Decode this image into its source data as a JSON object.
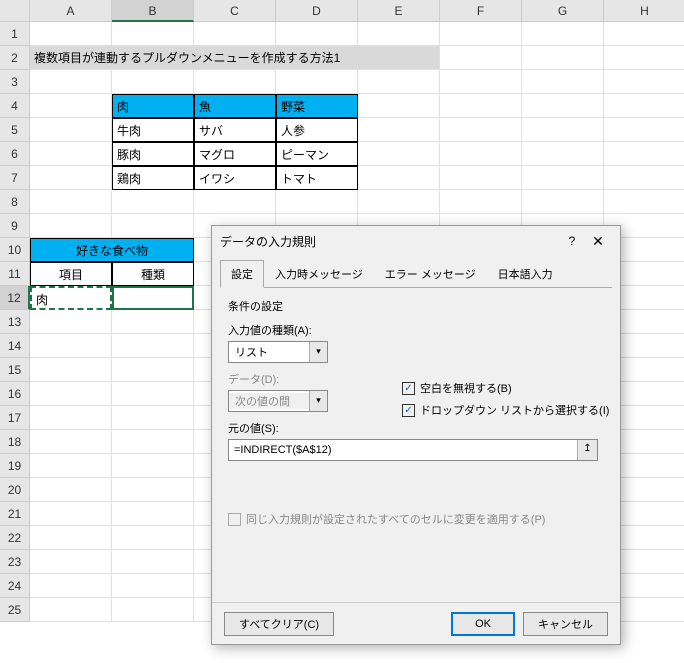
{
  "columns": [
    "A",
    "B",
    "C",
    "D",
    "E",
    "F",
    "G",
    "H"
  ],
  "rows": [
    "1",
    "2",
    "3",
    "4",
    "5",
    "6",
    "7",
    "8",
    "9",
    "10",
    "11",
    "12",
    "13",
    "14",
    "15",
    "16",
    "17",
    "18",
    "19",
    "20",
    "21",
    "22",
    "23",
    "24",
    "25"
  ],
  "title_row": "複数項目が連動するプルダウンメニューを作成する方法1",
  "table": {
    "headers": [
      "肉",
      "魚",
      "野菜"
    ],
    "data": [
      [
        "牛肉",
        "サバ",
        "人参"
      ],
      [
        "豚肉",
        "マグロ",
        "ピーマン"
      ],
      [
        "鶏肉",
        "イワシ",
        "トマト"
      ]
    ]
  },
  "fav": {
    "title": "好きな食べ物",
    "col1": "項目",
    "col2": "種類",
    "val1": "肉"
  },
  "dialog": {
    "title": "データの入力規則",
    "help": "?",
    "close": "✕",
    "tabs": [
      "設定",
      "入力時メッセージ",
      "エラー メッセージ",
      "日本語入力"
    ],
    "section": "条件の設定",
    "type_label": "入力値の種類(A):",
    "type_value": "リスト",
    "check1": "空白を無視する(B)",
    "check2": "ドロップダウン リストから選択する(I)",
    "data_label": "データ(D):",
    "data_value": "次の値の間",
    "source_label": "元の値(S):",
    "source_value": "=INDIRECT($A$12)",
    "apply_all": "同じ入力規則が設定されたすべてのセルに変更を適用する(P)",
    "clear": "すべてクリア(C)",
    "ok": "OK",
    "cancel": "キャンセル"
  }
}
